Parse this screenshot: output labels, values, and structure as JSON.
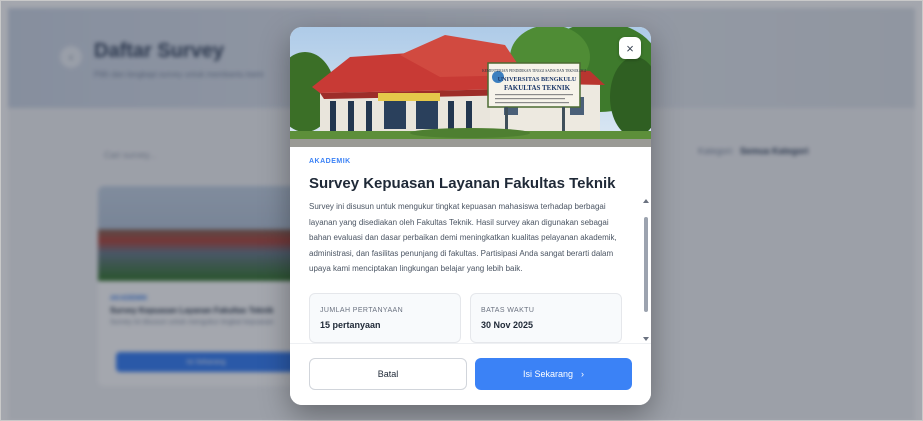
{
  "background": {
    "title": "Daftar Survey",
    "subtitle": "Pilih dan lengkapi survey untuk membantu kami",
    "search_placeholder": "Cari survey...",
    "filter_label": "Kategori:",
    "filter_value": "Semua Kategori",
    "card": {
      "category": "AKADEMIK",
      "title": "Survey Kepuasan Layanan Fakultas Teknik",
      "desc": "Survey ini disusun untuk mengukur tingkat kepuasan",
      "button": "Isi Sekarang"
    }
  },
  "modal": {
    "image": {
      "sign_line1": "KEMENTERIAN PENDIDIKAN TINGGI SAINS DAN TEKNOLOGI",
      "sign_line2": "UNIVERSITAS BENGKULU",
      "sign_line3": "FAKULTAS TEKNIK"
    },
    "close_icon": "×",
    "category": "AKADEMIK",
    "title": "Survey Kepuasan Layanan Fakultas Teknik",
    "description": "Survey ini disusun untuk mengukur tingkat kepuasan mahasiswa terhadap berbagai layanan yang disediakan oleh Fakultas Teknik. Hasil survey akan digunakan sebagai bahan evaluasi dan dasar perbaikan demi meningkatkan kualitas pelayanan akademik, administrasi, dan fasilitas penunjang di fakultas. Partisipasi Anda sangat berarti dalam upaya kami menciptakan lingkungan belajar yang lebih baik.",
    "info": [
      {
        "label": "JUMLAH PERTANYAAN",
        "value": "15 pertanyaan"
      },
      {
        "label": "BATAS WAKTU",
        "value": "30 Nov 2025"
      }
    ],
    "cancel_label": "Batal",
    "submit_label": "Isi Sekarang",
    "submit_icon": "›"
  },
  "colors": {
    "accent": "#3b82f6",
    "overlay": "rgba(15,23,42,0.38)"
  }
}
